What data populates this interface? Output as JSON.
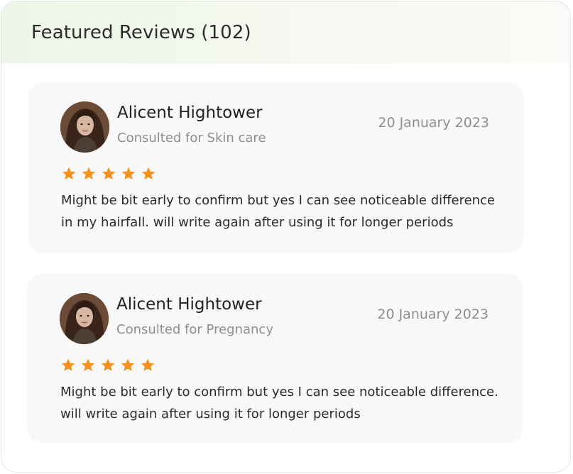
{
  "header": {
    "title": "Featured Reviews (102)"
  },
  "reviews": [
    {
      "name": "Alicent Hightower",
      "consulted": "Consulted for Skin care",
      "date": "20 January 2023",
      "rating": 5,
      "text": "Might be bit early to confirm but yes I can see noticeable difference in my hairfall. will write again after using it for longer periods"
    },
    {
      "name": "Alicent Hightower",
      "consulted": "Consulted for Pregnancy",
      "date": "20 January 2023",
      "rating": 5,
      "text": "Might be bit early to confirm but yes I can see noticeable difference. will write again after using it for longer periods"
    }
  ],
  "colors": {
    "star": "#f5921e",
    "card_bg": "#f8f8f8",
    "header_gradient_start": "#eef5e6"
  },
  "icons": {
    "star": "star-icon",
    "avatar": "avatar"
  }
}
